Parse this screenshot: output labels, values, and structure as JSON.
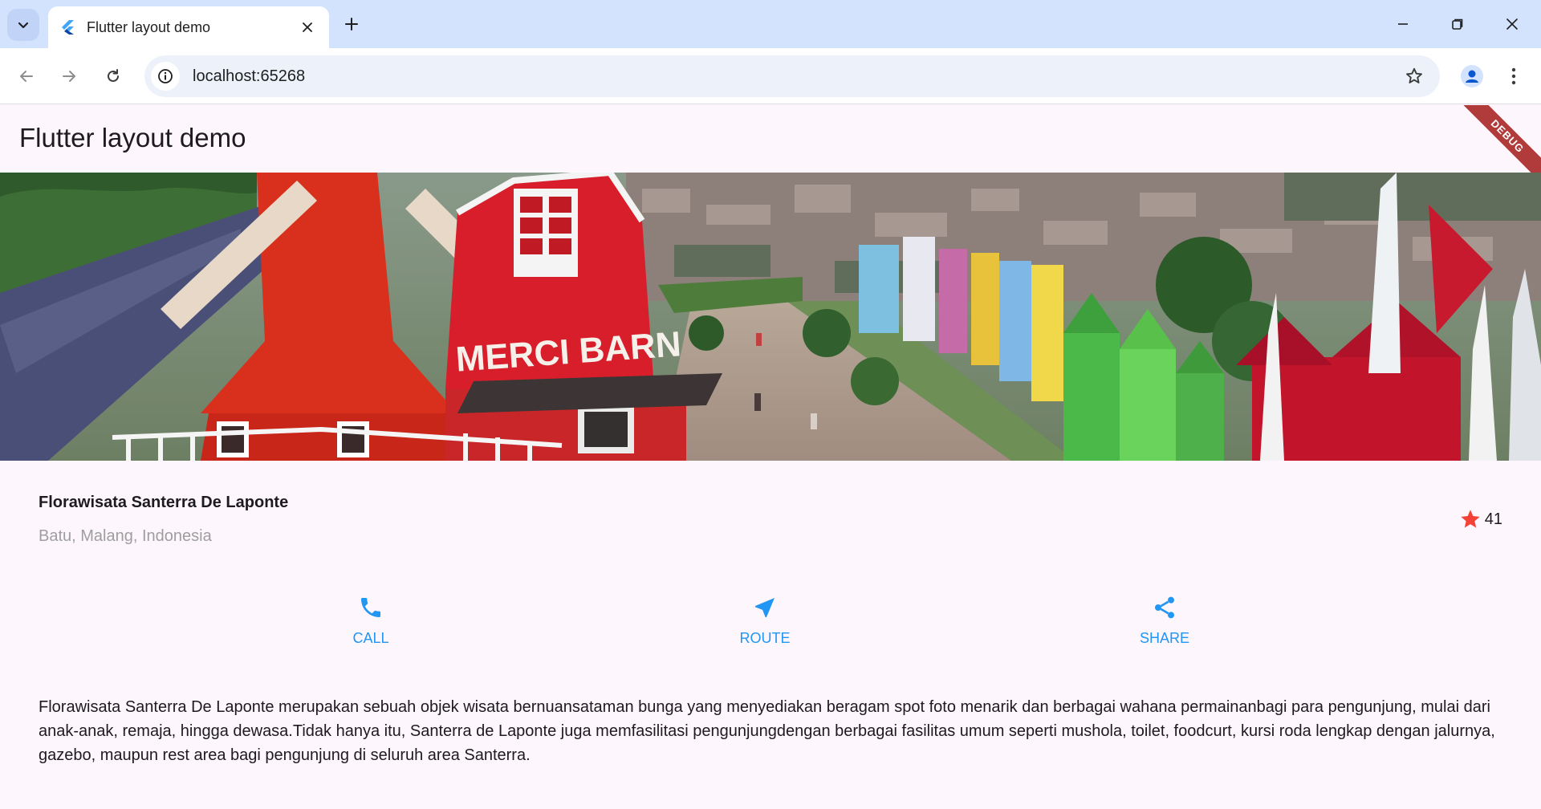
{
  "browser": {
    "tab_title": "Flutter layout demo",
    "url": "localhost:65268"
  },
  "app": {
    "appbar_title": "Flutter layout demo",
    "debug_banner": "DEBUG",
    "place_name": "Florawisata Santerra De Laponte",
    "place_location": "Batu, Malang, Indonesia",
    "rating_count": "41",
    "actions": [
      {
        "label": "CALL",
        "icon": "phone-icon"
      },
      {
        "label": "ROUTE",
        "icon": "near-me-icon"
      },
      {
        "label": "SHARE",
        "icon": "share-icon"
      }
    ],
    "description": "Florawisata Santerra De Laponte merupakan sebuah objek wisata bernuansataman bunga yang menyediakan beragam spot foto menarik dan berbagai wahana permainanbagi para pengunjung, mulai dari anak-anak, remaja, hingga dewasa.Tidak hanya itu, Santerra de Laponte juga memfasilitasi pengunjungdengan berbagai fasilitas umum seperti mushola, toilet, foodcurt, kursi roda lengkap dengan jalurnya, gazebo, maupun rest area bagi pengunjung di seluruh area Santerra.",
    "hero_image_text": "MERCI BARN"
  },
  "colors": {
    "accent_blue": "#2196f3",
    "star_red": "#f44336",
    "app_background": "#fdf6fd",
    "tabstrip": "#d3e3fd"
  }
}
